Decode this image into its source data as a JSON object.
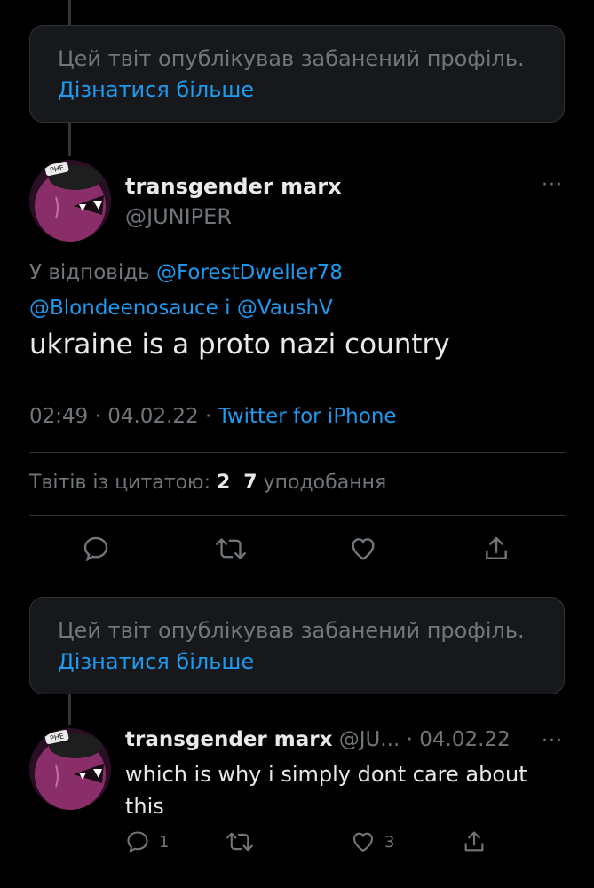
{
  "banned_notice": {
    "text": "Цей твіт опублікував забанений профіль.",
    "learn_more": "Дізнатися більше"
  },
  "main_tweet": {
    "author_name": "transgender marx",
    "author_handle": "@JUNIPER",
    "more": "···",
    "reply_prefix": "У відповідь",
    "reply_mention_1": "@ForestDweller78",
    "reply_mention_2": "@Blondeenosauce",
    "reply_joiner": "і",
    "reply_mention_3": "@VaushV",
    "text": "ukraine is a proto nazi country",
    "time": "02:49",
    "sep": "·",
    "date": "04.02.22",
    "source": "Twitter for iPhone",
    "quotes_label": "Твітів із цитатою:",
    "quotes_count": "2",
    "likes_count": "7",
    "likes_label": "уподобання"
  },
  "reply_tweet": {
    "author_name": "transgender marx",
    "author_handle": "@JU...",
    "sep": "·",
    "date": "04.02.22",
    "more": "···",
    "text": "which is why i simply dont care about this",
    "reply_count": "1",
    "retweet_count": "",
    "like_count": "3"
  },
  "avatar": {
    "hat_text": "РНЕ",
    "colors": {
      "face": "#8a2e6a",
      "hat": "#1e1e1e"
    }
  },
  "colors": {
    "background": "#000000",
    "text": "#e7e9ea",
    "secondary": "#71767b",
    "link": "#1d9bf0",
    "box": "#16181c"
  }
}
